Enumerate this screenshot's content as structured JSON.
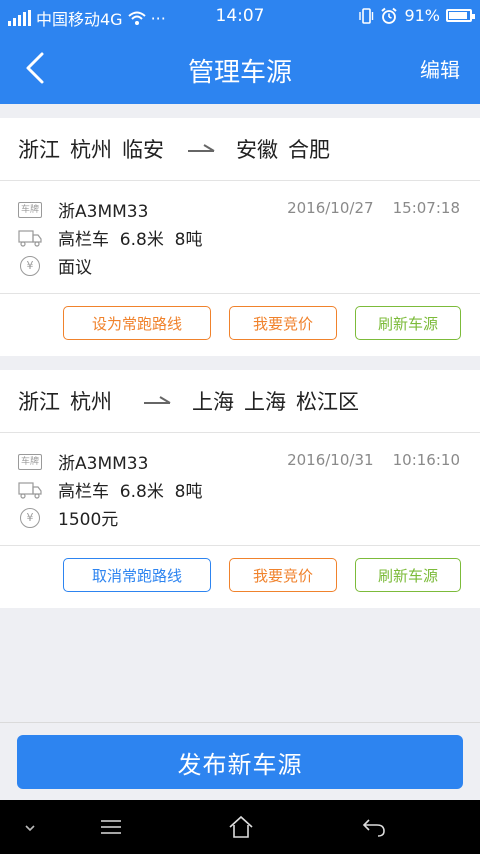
{
  "status_bar": {
    "carrier": "中国移动4G",
    "dots": "···",
    "time": "14:07",
    "battery_percent": "91%",
    "battery_level": 0.91
  },
  "header": {
    "title": "管理车源",
    "edit_label": "编辑"
  },
  "listings": [
    {
      "origin": [
        "浙江",
        "杭州",
        "临安"
      ],
      "destination": [
        "安徽",
        "合肥"
      ],
      "plate": "浙A3MM33",
      "date": "2016/10/27",
      "time": "15:07:18",
      "truck": "高栏车  6.8米  8吨",
      "price": "面议",
      "actions": [
        "设为常跑路线",
        "我要竞价",
        "刷新车源"
      ]
    },
    {
      "origin": [
        "浙江",
        "杭州"
      ],
      "destination": [
        "上海",
        "上海",
        "松江区"
      ],
      "plate": "浙A3MM33",
      "date": "2016/10/31",
      "time": "10:16:10",
      "truck": "高栏车  6.8米  8吨",
      "price": "1500元",
      "actions": [
        "取消常跑路线",
        "我要竞价",
        "刷新车源"
      ]
    }
  ],
  "icons": {
    "plate_label": "车牌",
    "yen": "¥"
  },
  "publish_label": "发布新车源",
  "colors": {
    "brand_blue": "#2d84f0",
    "orange": "#f0822c",
    "green": "#7cbb3a"
  }
}
